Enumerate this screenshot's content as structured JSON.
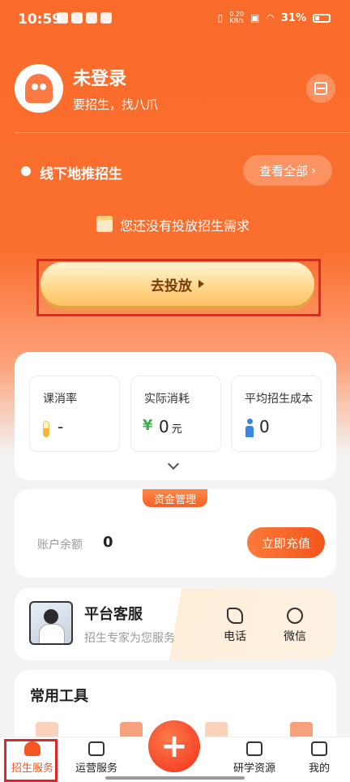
{
  "status_bar": {
    "time": "10:59",
    "speed_value": "0.20",
    "speed_unit": "KB/s",
    "battery": "31%"
  },
  "profile": {
    "name": "未登录",
    "subtitle": "要招生，找八爪"
  },
  "section": {
    "title": "线下地推招生",
    "view_all": "查看全部",
    "empty_text": "您还没有投放招生需求",
    "cta_label": "去投放"
  },
  "stats": [
    {
      "label": "课消率",
      "value": "-",
      "unit": ""
    },
    {
      "label": "实际消耗",
      "value": "0",
      "unit": "元",
      "icon_char": "¥"
    },
    {
      "label": "平均招生成本",
      "value": "0",
      "unit": ""
    }
  ],
  "funds": {
    "tag": "资金管理",
    "balance_label": "账户余额",
    "balance_value": "0",
    "recharge_label": "立即充值"
  },
  "service": {
    "title": "平台客服",
    "subtitle": "招生专家为您服务",
    "phone_label": "电话",
    "wechat_label": "微信"
  },
  "tools": {
    "title": "常用工具"
  },
  "nav": {
    "items": [
      "招生服务",
      "运营服务",
      "研学资源",
      "我的"
    ],
    "fab_symbol": "+"
  },
  "colors": {
    "brand": "#f96b2a",
    "accent": "#f4561d",
    "highlight": "#e0252b"
  }
}
